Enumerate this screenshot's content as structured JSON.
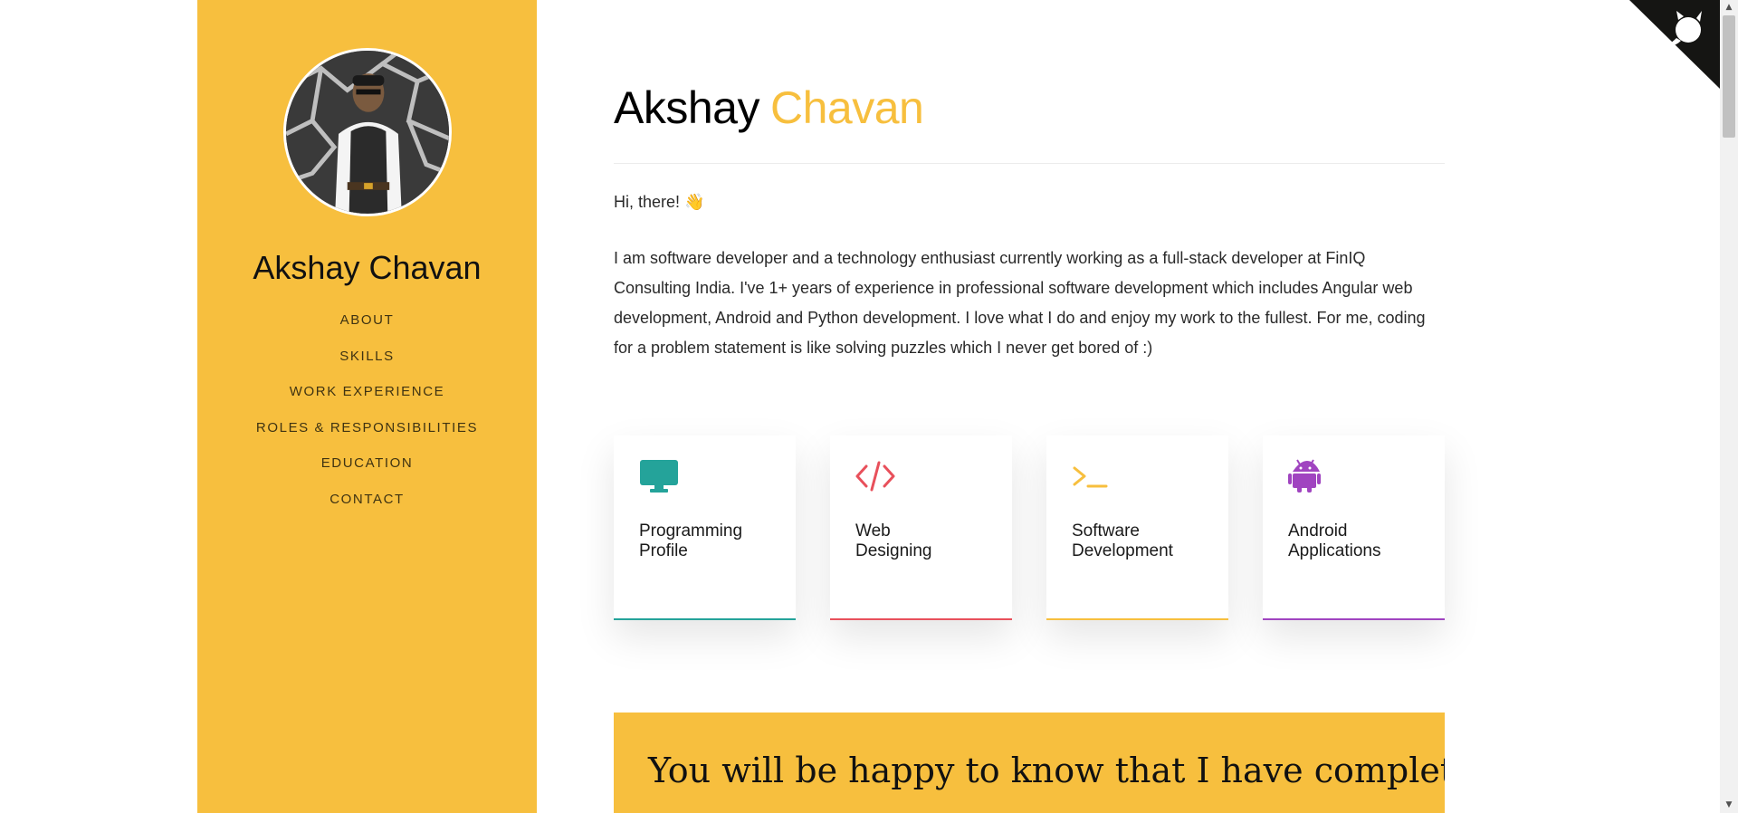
{
  "sidebar": {
    "name": "Akshay Chavan",
    "nav": [
      "ABOUT",
      "SKILLS",
      "WORK EXPERIENCE",
      "ROLES & RESPONSIBILITIES",
      "EDUCATION",
      "CONTACT"
    ]
  },
  "header": {
    "first_name": "Akshay",
    "last_name": "Chavan"
  },
  "about": {
    "greeting": "Hi, there! 👋",
    "intro": "I am software developer and a technology enthusiast currently working as a full-stack developer at FinIQ Consulting India. I've 1+ years of experience in professional software development which includes Angular web development, Android and Python development. I love what I do and enjoy my work to the fullest. For me, coding for a problem statement is like solving puzzles which I never get bored of :)"
  },
  "services": [
    {
      "label": "Programming\nProfile",
      "icon": "desktop-icon",
      "color": "#24a39a"
    },
    {
      "label": "Web\nDesigning",
      "icon": "code-icon",
      "color": "#e8505b"
    },
    {
      "label": "Software\nDevelopment",
      "icon": "terminal-icon",
      "color": "#f7bf3e"
    },
    {
      "label": "Android\nApplications",
      "icon": "android-icon",
      "color": "#a044c0"
    }
  ],
  "banner": {
    "text": "You will be happy to know that I have completed"
  },
  "colors": {
    "accent": "#f7bf3e",
    "sidebar_bg": "#f7bf3e"
  }
}
